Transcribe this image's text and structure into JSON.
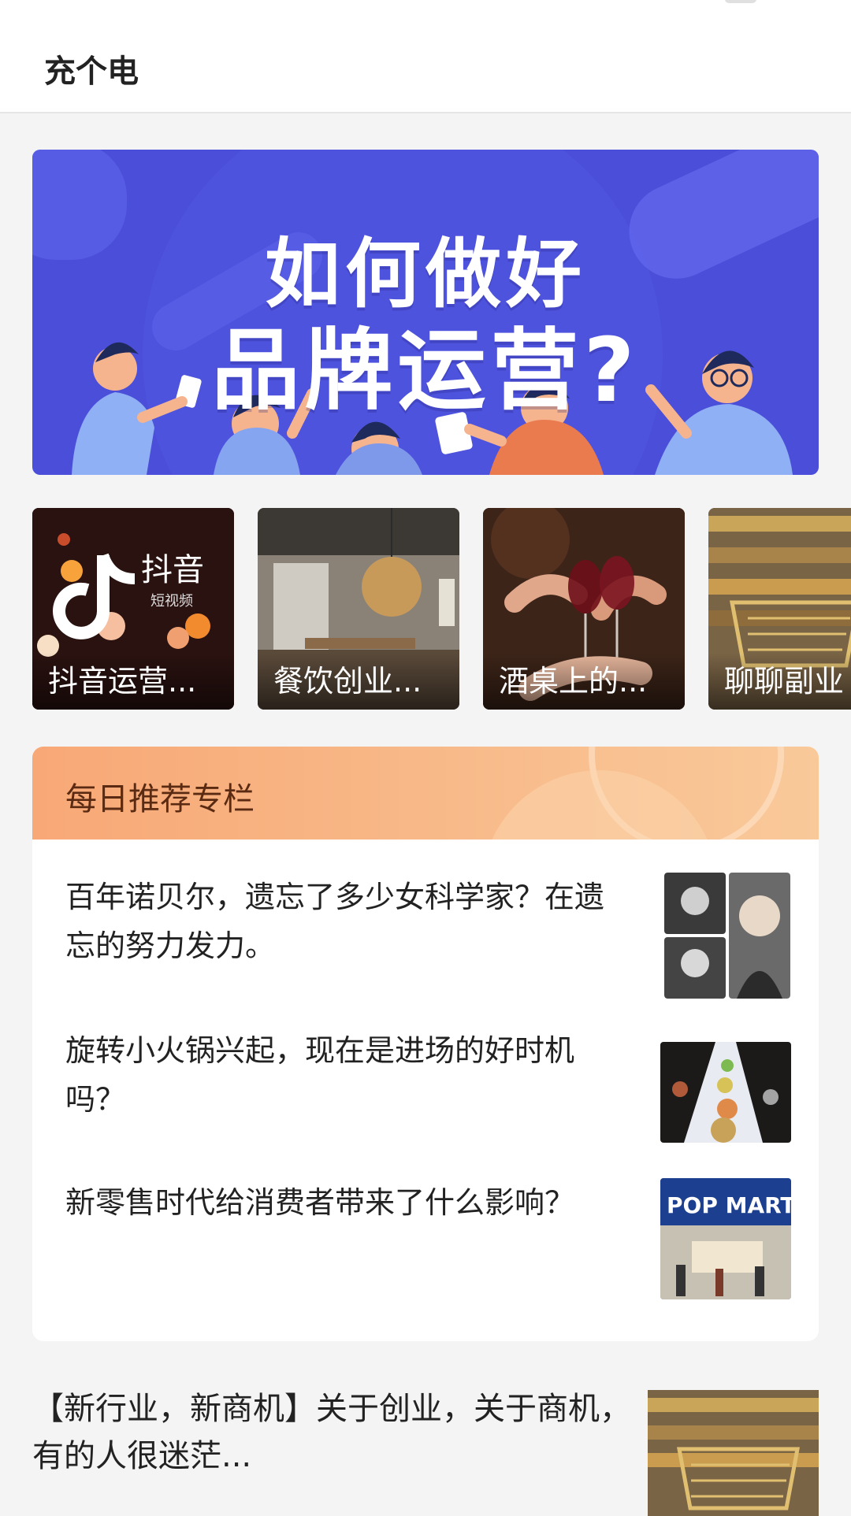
{
  "header": {
    "title": "充个电"
  },
  "banner": {
    "line1": "如何做好",
    "line2": "品牌运营?"
  },
  "cards": [
    {
      "label": "抖音运营...",
      "image": "douyin-logo"
    },
    {
      "label": "餐饮创业...",
      "image": "restaurant-interior"
    },
    {
      "label": "酒桌上的...",
      "image": "wine-toast"
    },
    {
      "label": "聊聊副业",
      "image": "supermarket-cart"
    }
  ],
  "recommend": {
    "title": "每日推荐专栏",
    "items": [
      {
        "text": "百年诺贝尔，遗忘了多少女科学家？在遗忘的努力发力。",
        "image": "women-scientists-portraits"
      },
      {
        "text": "旋转小火锅兴起，现在是进场的好时机吗？",
        "image": "conveyor-hotpot"
      },
      {
        "text": "新零售时代给消费者带来了什么影响？",
        "image": "pop-mart-store"
      }
    ]
  },
  "article": {
    "text": "【新行业，新商机】关于创业，关于商机，有的人很迷茫...",
    "image": "supermarket-cart"
  },
  "colors": {
    "banner": "#4a4ed8",
    "rec_header_start": "#f8a876",
    "rec_header_end": "#f9c99a",
    "page_bg": "#f4f4f5"
  }
}
